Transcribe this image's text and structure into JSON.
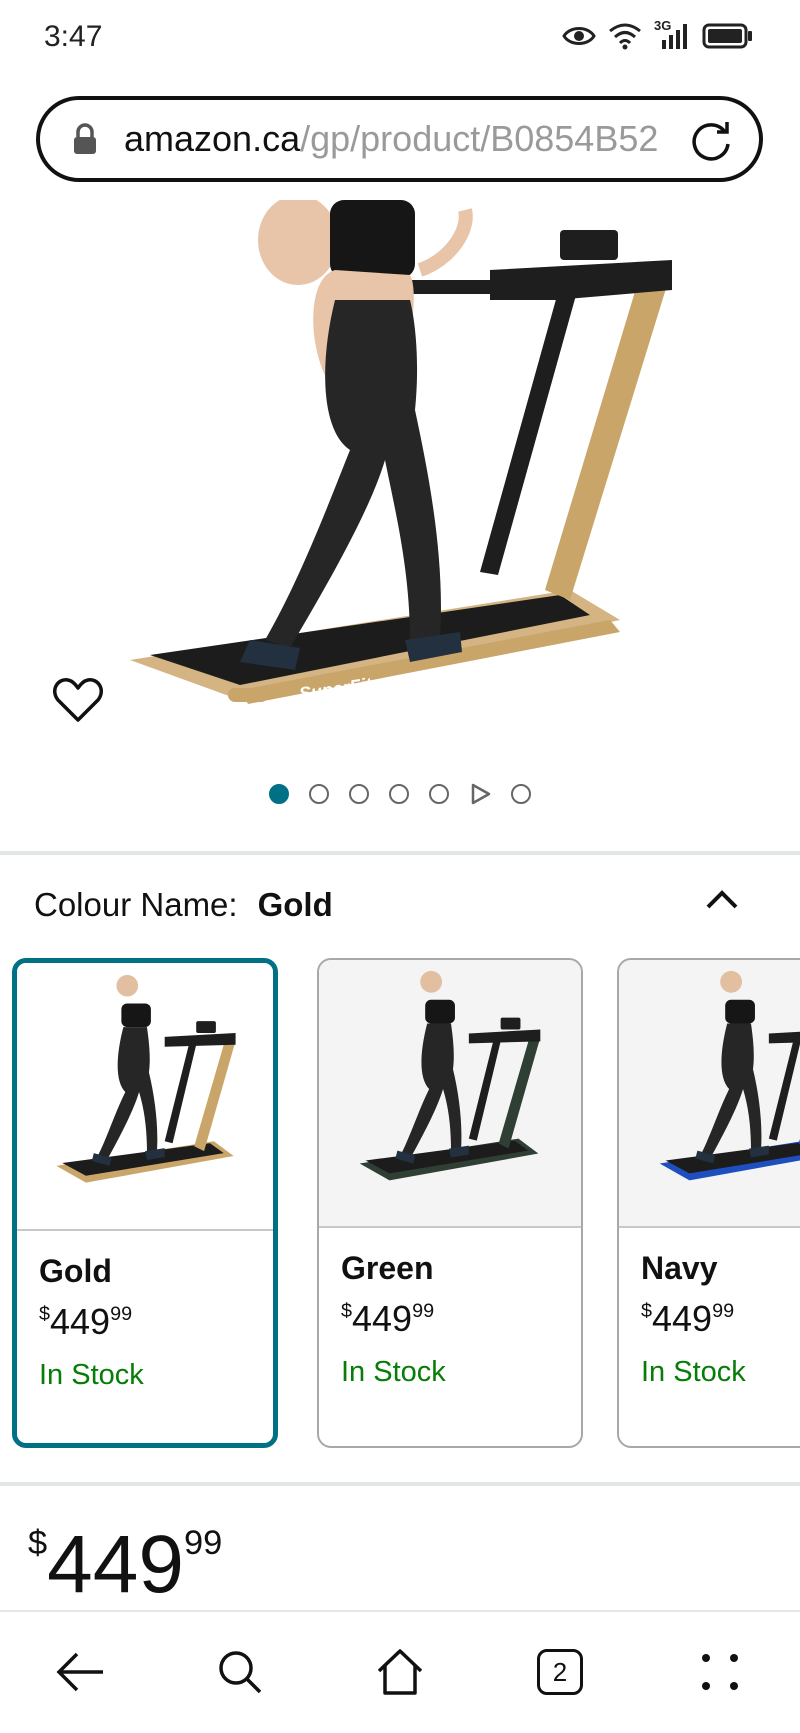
{
  "status_bar": {
    "time": "3:47",
    "network": "3G",
    "icons": [
      "eye-icon",
      "wifi-icon",
      "signal-icon",
      "battery-icon"
    ]
  },
  "browser": {
    "url_domain": "amazon.ca",
    "url_path": "/gp/product/B0854B52"
  },
  "product_gallery": {
    "brand_on_deck": "SuperFit",
    "image_count": 7,
    "active_index": 0
  },
  "variation": {
    "label": "Colour Name:",
    "selected": "Gold",
    "options": [
      {
        "name": "Gold",
        "currency": "$",
        "whole": "449",
        "fraction": "99",
        "stock": "In Stock",
        "frame_color": "#c9a56a"
      },
      {
        "name": "Green",
        "currency": "$",
        "whole": "449",
        "fraction": "99",
        "stock": "In Stock",
        "frame_color": "#2f3f34"
      },
      {
        "name": "Navy",
        "currency": "$",
        "whole": "449",
        "fraction": "99",
        "stock": "In Stock",
        "frame_color": "#1f4fbf"
      }
    ]
  },
  "price": {
    "currency": "$",
    "whole": "449",
    "fraction": "99"
  },
  "bottom_nav": {
    "tab_count": "2"
  },
  "colors": {
    "accent": "#007185",
    "in_stock": "#067d06"
  }
}
